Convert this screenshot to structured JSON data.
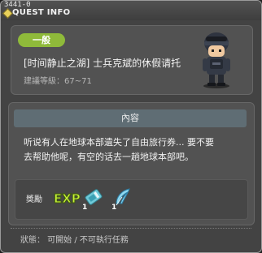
{
  "window": {
    "quest_id": "3441-0",
    "title": "QUEST INFO"
  },
  "quest": {
    "category": "一般",
    "name": "[时间静止之湖] 士兵克斌的休假请托",
    "level": "建議等級：67~71"
  },
  "content": {
    "header": "內容",
    "description_lines": [
      "听说有人在地球本部遺失了自由旅行券... 要不要",
      "去帮助他呢，有空的话去一趟地球本部吧。"
    ]
  },
  "rewards": {
    "label": "獎勵",
    "items": [
      {
        "icon": "exp-icon",
        "text": "EXP"
      },
      {
        "icon": "ticket-icon",
        "count": "1"
      },
      {
        "icon": "feather-icon",
        "count": "1"
      }
    ]
  },
  "status": {
    "text": "狀態： 可開始 / 不可執行任務"
  },
  "colors": {
    "badge": "#8fba3a",
    "panel": "#525252",
    "header_bar": "#5f6d74",
    "window_bg": "#434343"
  }
}
